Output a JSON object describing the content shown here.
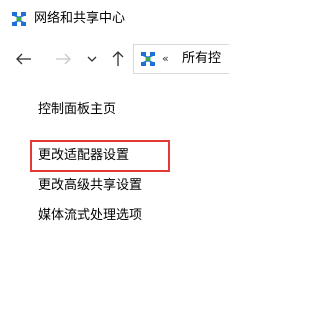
{
  "window": {
    "title": "网络和共享中心",
    "icon": "network-sharing-center-icon"
  },
  "navigation": {
    "back_icon": "arrow-left-icon",
    "forward_icon": "arrow-right-icon",
    "recent_icon": "chevron-down-icon",
    "up_icon": "arrow-up-icon"
  },
  "address_bar": {
    "separator": "«",
    "path_text": "所有控"
  },
  "sidebar": {
    "items": [
      {
        "label": "控制面板主页"
      },
      {
        "label": "更改适配器设置"
      },
      {
        "label": "更改高级共享设置"
      },
      {
        "label": "媒体流式处理选项"
      }
    ]
  },
  "colors": {
    "highlight_border": "#e53935",
    "network_icon_blue": "#1e6fd9",
    "network_icon_green": "#3fae3f"
  }
}
